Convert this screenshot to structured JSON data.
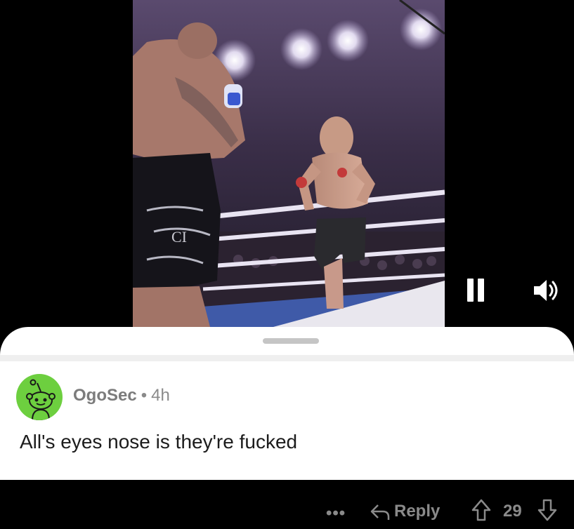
{
  "video": {
    "background_color": "#000000",
    "controls": {
      "pause_icon": "pause-icon",
      "volume_icon": "volume-icon"
    }
  },
  "comment": {
    "avatar_icon": "snoo-avatar-icon",
    "username": "OgoSec",
    "separator": "•",
    "time": "4h",
    "text": "All's eyes nose is they're fucked",
    "avatar_color": "#6dcf3f"
  },
  "actions": {
    "more": "•••",
    "reply_label": "Reply",
    "vote_count": "29"
  }
}
